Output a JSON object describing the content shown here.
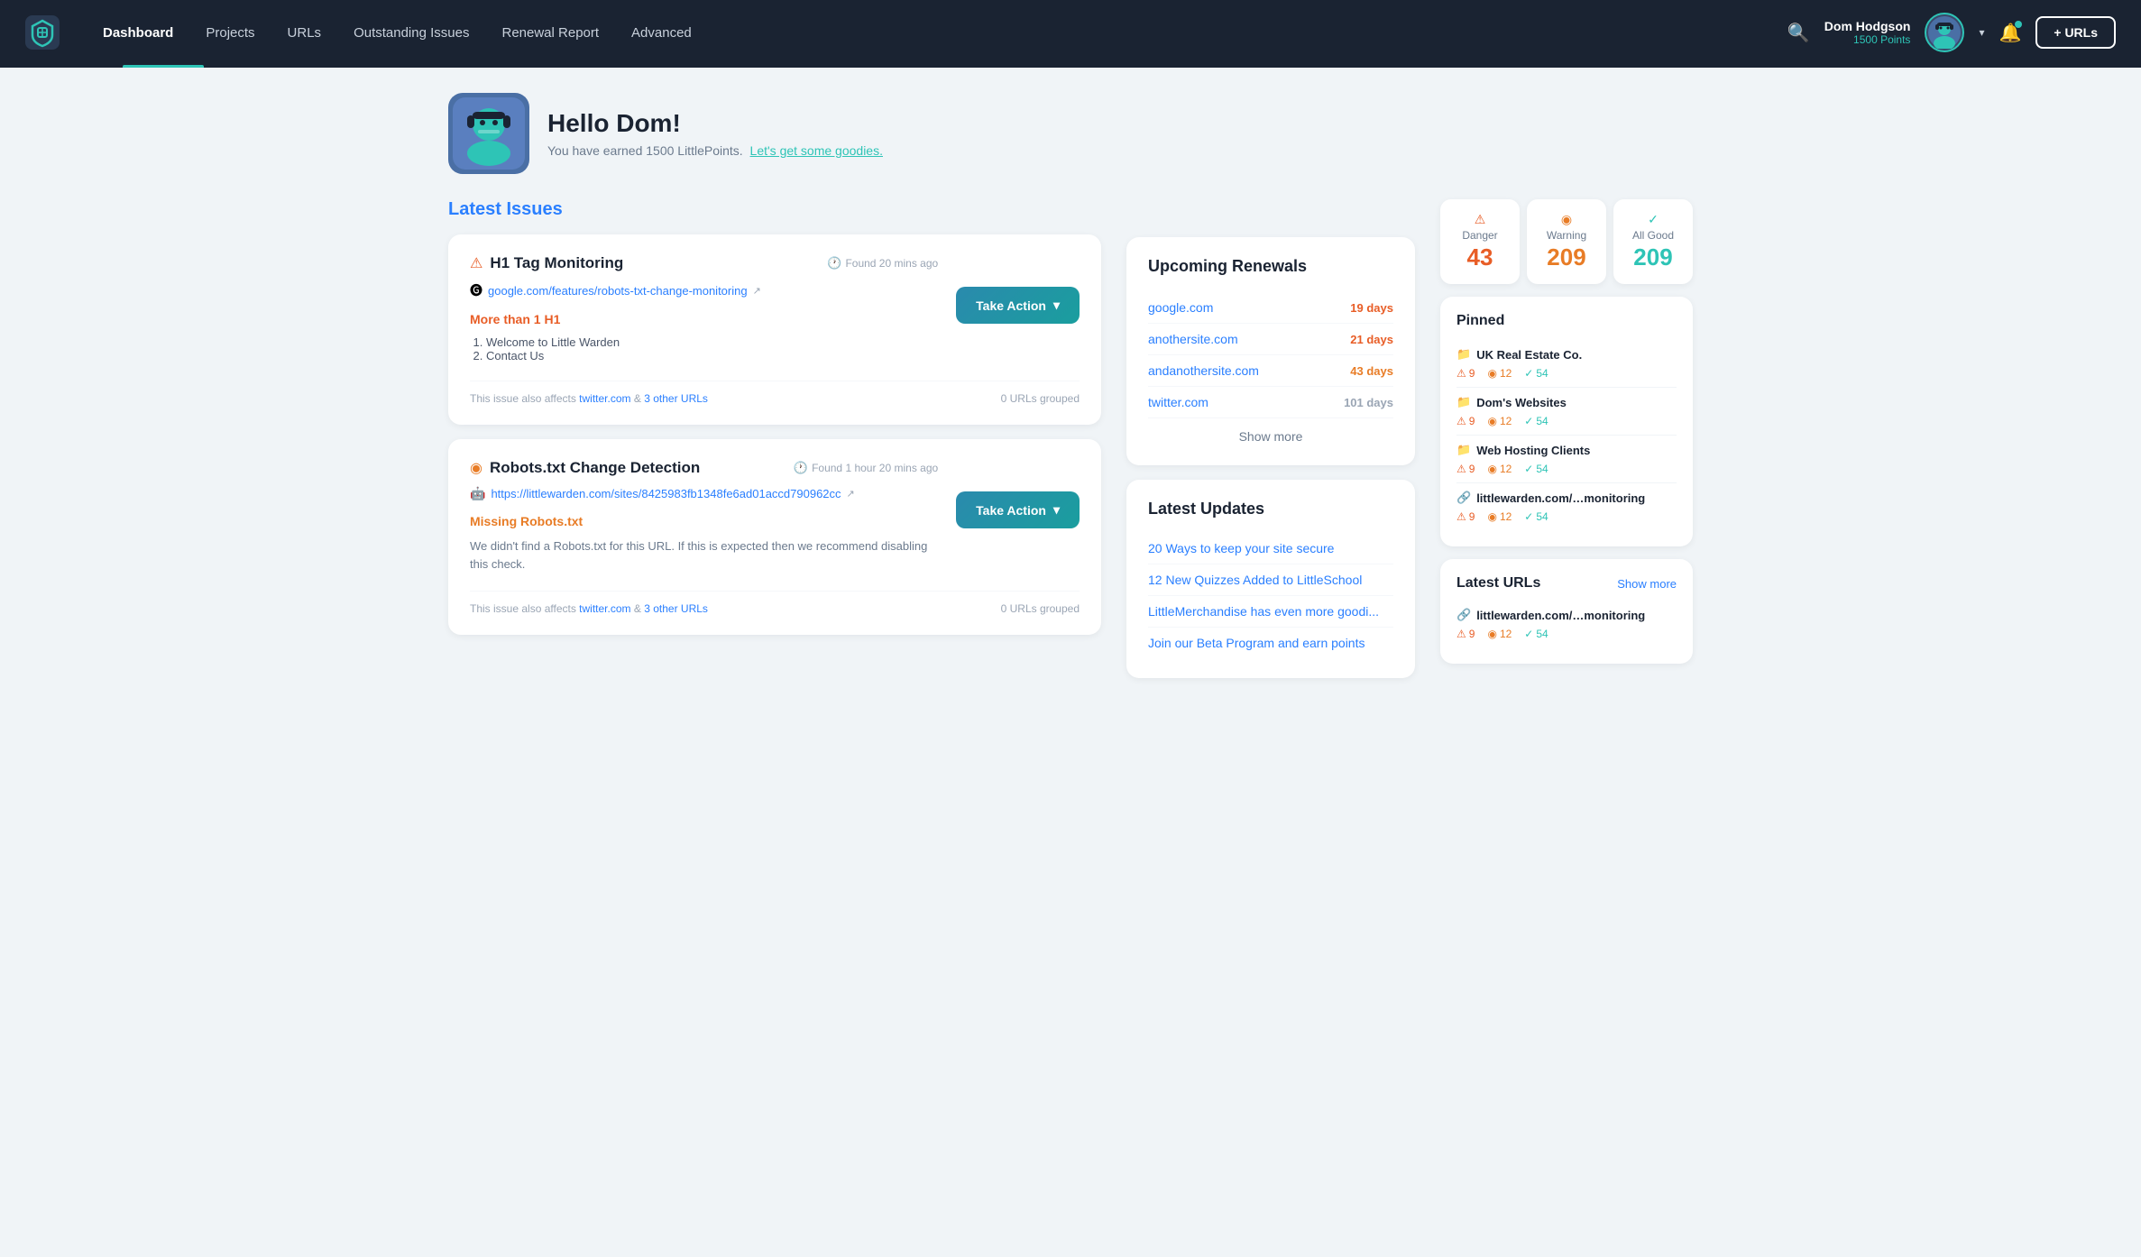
{
  "nav": {
    "logo_alt": "LittleWarden Logo",
    "links": [
      {
        "label": "Dashboard",
        "active": true
      },
      {
        "label": "Projects",
        "active": false
      },
      {
        "label": "URLs",
        "active": false
      },
      {
        "label": "Outstanding Issues",
        "active": false
      },
      {
        "label": "Renewal Report",
        "active": false
      },
      {
        "label": "Advanced",
        "active": false
      }
    ],
    "user": {
      "name": "Dom Hodgson",
      "points": "1500 Points"
    },
    "add_btn": "+ URLs",
    "search_placeholder": "Search..."
  },
  "welcome": {
    "greeting": "Hello Dom!",
    "subtitle": "You have earned 1500 LittlePoints.",
    "cta_link": "Let's get some goodies."
  },
  "stats": {
    "danger": {
      "label": "Danger",
      "value": "43"
    },
    "warning": {
      "label": "Warning",
      "value": "209"
    },
    "good": {
      "label": "All Good",
      "value": "209"
    }
  },
  "latest_issues": {
    "title": "Latest Issues",
    "items": [
      {
        "icon": "warning",
        "title": "H1 Tag Monitoring",
        "time": "Found 20 mins ago",
        "url": "google.com/features/robots-txt-change-monitoring",
        "problem_label": "More than 1 H1",
        "problem_color": "red",
        "list_items": [
          "Welcome to Little Warden",
          "Contact Us"
        ],
        "affects": "twitter.com",
        "affects_extra": "3 other URLs",
        "grouped": "0 URLs grouped",
        "action_btn": "Take Action"
      },
      {
        "icon": "circle-warning",
        "title": "Robots.txt Change Detection",
        "time": "Found 1 hour 20 mins ago",
        "url": "https://littlewarden.com/sites/8425983fb1348fe6ad01accd790962cc",
        "problem_label": "Missing Robots.txt",
        "problem_color": "orange",
        "description": "We didn't find a Robots.txt for this URL. If this is expected then we recommend disabling this check.",
        "affects": "twitter.com",
        "affects_extra": "3 other URLs",
        "grouped": "0 URLs grouped",
        "action_btn": "Take Action"
      }
    ]
  },
  "renewals": {
    "title": "Upcoming Renewals",
    "items": [
      {
        "domain": "google.com",
        "days": "19 days",
        "color": "soon"
      },
      {
        "domain": "anothersite.com",
        "days": "21 days",
        "color": "soon"
      },
      {
        "domain": "andanothersite.com",
        "days": "43 days",
        "color": "medium"
      },
      {
        "domain": "twitter.com",
        "days": "101 days",
        "color": "ok"
      }
    ],
    "show_more": "Show more"
  },
  "updates": {
    "title": "Latest Updates",
    "items": [
      "20 Ways to keep your site secure",
      "12 New Quizzes Added to LittleSchool",
      "LittleMerchandise has even more goodi...",
      "Join our Beta Program and earn points"
    ]
  },
  "pinned": {
    "title": "Pinned",
    "items": [
      {
        "name": "UK Real Estate Co.",
        "type": "folder",
        "danger": 9,
        "warning": 12,
        "good": 54
      },
      {
        "name": "Dom's Websites",
        "type": "folder",
        "danger": 9,
        "warning": 12,
        "good": 54
      },
      {
        "name": "Web Hosting Clients",
        "type": "folder",
        "danger": 9,
        "warning": 12,
        "good": 54
      },
      {
        "name": "littlewarden.com/…monitoring",
        "type": "link",
        "danger": 9,
        "warning": 12,
        "good": 54
      }
    ]
  },
  "latest_urls": {
    "title": "Latest URLs",
    "show_more": "Show more",
    "items": [
      {
        "name": "littlewarden.com/…monitoring",
        "type": "link",
        "danger": 9,
        "warning": 12,
        "good": 54
      }
    ]
  }
}
